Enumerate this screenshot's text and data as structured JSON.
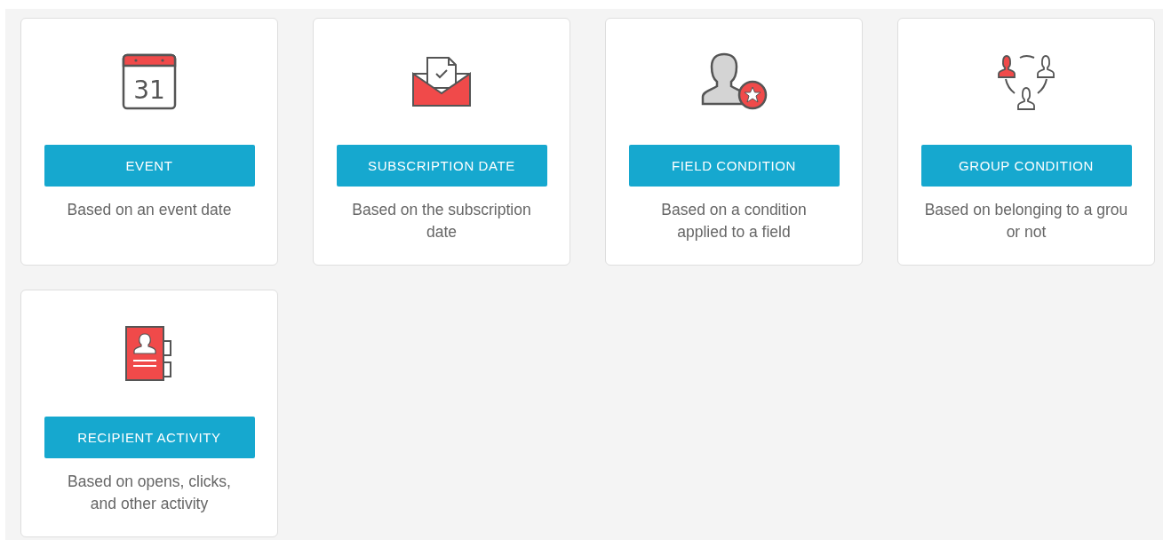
{
  "cards": [
    {
      "kind": "calendar",
      "day": "31",
      "button": "EVENT",
      "description": "Based on an event date"
    },
    {
      "kind": "envelope",
      "button": "SUBSCRIPTION DATE",
      "description": "Based on the subscription\ndate"
    },
    {
      "kind": "user",
      "button": "FIELD CONDITION",
      "description": "Based on a condition\napplied to a field"
    },
    {
      "kind": "group",
      "button": "GROUP CONDITION",
      "description": "Based on belonging to a grou\nor not"
    },
    {
      "kind": "contacts",
      "button": "RECIPIENT ACTIVITY",
      "description": "Based on opens, clicks,\nand other activity"
    }
  ]
}
